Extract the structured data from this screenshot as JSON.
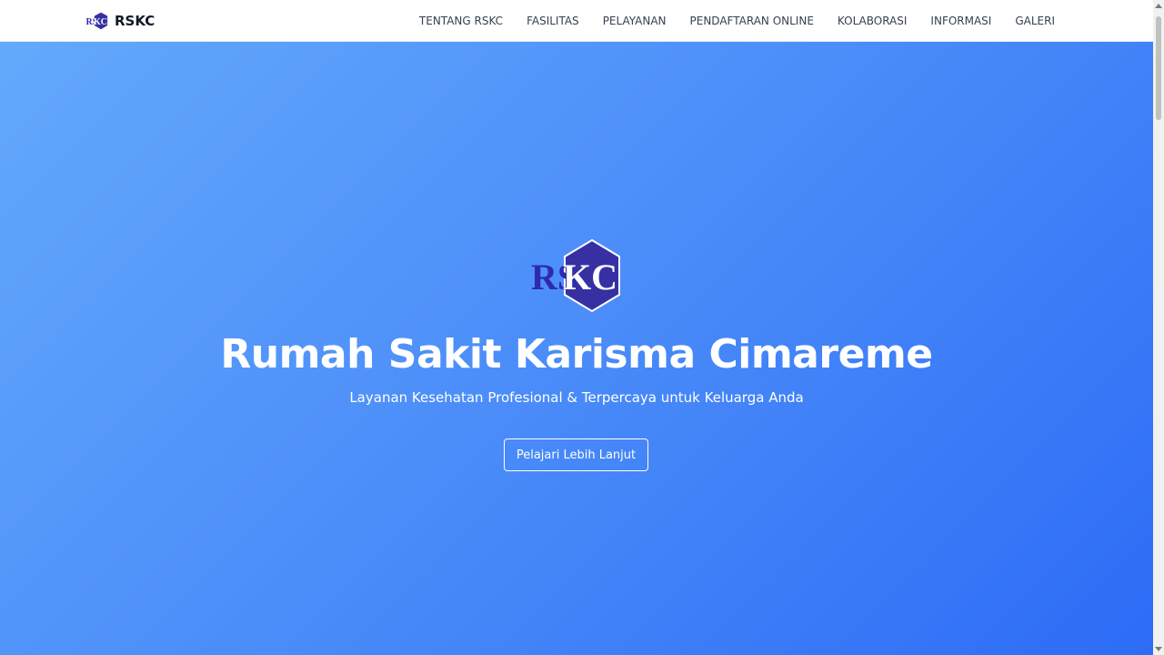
{
  "brand": {
    "logo_letters_left": "RS",
    "logo_letters_right": "KC",
    "name": "RSKC"
  },
  "nav": {
    "items": [
      {
        "label": "TENTANG RSKC"
      },
      {
        "label": "FASILITAS"
      },
      {
        "label": "PELAYANAN"
      },
      {
        "label": "PENDAFTARAN ONLINE"
      },
      {
        "label": "KOLABORASI"
      },
      {
        "label": "INFORMASI"
      },
      {
        "label": "GALERI"
      }
    ]
  },
  "hero": {
    "logo_letters_left": "RS",
    "logo_letters_right": "KC",
    "title": "Rumah Sakit Karisma Cimareme",
    "subtitle": "Layanan Kesehatan Profesional & Terpercaya untuk Keluarga Anda",
    "cta_label": "Pelajari Lebih Lanjut"
  },
  "colors": {
    "gradient_start": "#63a9fb",
    "gradient_end": "#2d6cf6",
    "logo_primary": "#3730a3",
    "logo_text_left": "#2e2ab0"
  },
  "icons": [
    "rskc-logo-icon"
  ]
}
